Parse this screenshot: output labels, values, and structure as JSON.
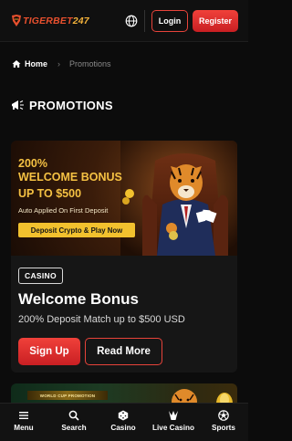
{
  "header": {
    "logo": "TIGERBET247",
    "logo_main": "TIGERBET",
    "logo_num": "247",
    "globe_icon": "globe-icon",
    "login_label": "Login",
    "register_label": "Register"
  },
  "breadcrumb": {
    "home_icon": "home-icon",
    "home_label": "Home",
    "separator": "›",
    "current_label": "Promotions"
  },
  "page": {
    "title_icon": "megaphone-icon",
    "title": "PROMOTIONS"
  },
  "promo": {
    "banner": {
      "line1": "200%",
      "line2": "WELCOME BONUS",
      "line3": "UP TO $500",
      "subtext": "Auto Applied On First Deposit",
      "cta": "Deposit Crypto & Play Now"
    },
    "tag": "CASINO",
    "title": "Welcome Bonus",
    "description": "200% Deposit Match up to $500 USD",
    "signup_label": "Sign Up",
    "readmore_label": "Read More"
  },
  "promo2": {
    "ribbon": "WORLD CUP PROMOTION"
  },
  "bottom_nav": {
    "items": [
      {
        "label": "Menu",
        "icon": "menu-icon"
      },
      {
        "label": "Search",
        "icon": "search-icon"
      },
      {
        "label": "Casino",
        "icon": "dice-icon"
      },
      {
        "label": "Live Casino",
        "icon": "live-casino-icon"
      },
      {
        "label": "Sports",
        "icon": "soccer-ball-icon"
      }
    ]
  },
  "colors": {
    "accent": "#e8433a",
    "gold": "#f5c143",
    "background": "#0c0c0c"
  }
}
